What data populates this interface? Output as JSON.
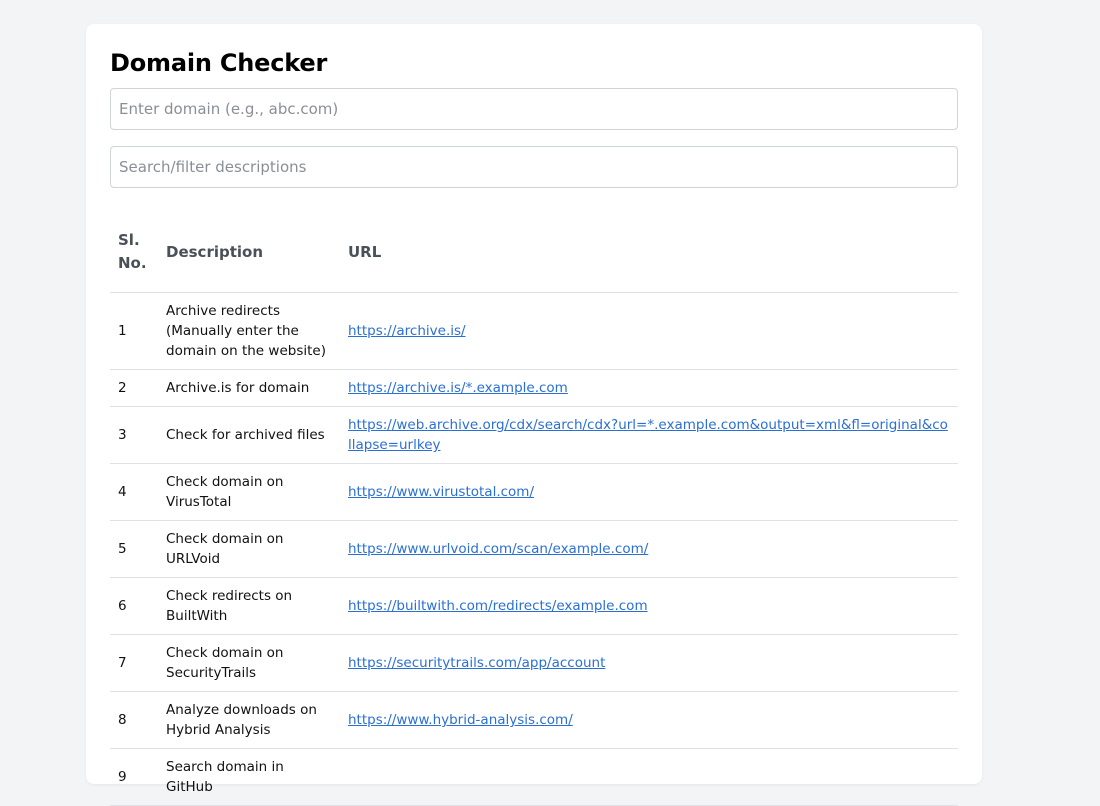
{
  "page": {
    "title": "Domain Checker"
  },
  "inputs": {
    "domain_placeholder": "Enter domain (e.g., abc.com)",
    "domain_value": "",
    "filter_placeholder": "Search/filter descriptions",
    "filter_value": ""
  },
  "table": {
    "headers": {
      "no": "Sl. No.",
      "description": "Description",
      "url": "URL"
    },
    "rows": [
      {
        "no": "1",
        "description": "Archive redirects (Manually enter the domain on the website)",
        "url": "https://archive.is/"
      },
      {
        "no": "2",
        "description": "Archive.is for domain",
        "url": "https://archive.is/*.example.com"
      },
      {
        "no": "3",
        "description": "Check for archived files",
        "url": "https://web.archive.org/cdx/search/cdx?url=*.example.com&output=xml&fl=original&collapse=urlkey"
      },
      {
        "no": "4",
        "description": "Check domain on VirusTotal",
        "url": "https://www.virustotal.com/"
      },
      {
        "no": "5",
        "description": "Check domain on URLVoid",
        "url": "https://www.urlvoid.com/scan/example.com/"
      },
      {
        "no": "6",
        "description": "Check redirects on BuiltWith",
        "url": "https://builtwith.com/redirects/example.com"
      },
      {
        "no": "7",
        "description": "Check domain on SecurityTrails",
        "url": "https://securitytrails.com/app/account"
      },
      {
        "no": "8",
        "description": "Analyze downloads on Hybrid Analysis",
        "url": "https://www.hybrid-analysis.com/"
      },
      {
        "no": "9",
        "description": "Search domain in GitHub",
        "url": ""
      }
    ]
  }
}
